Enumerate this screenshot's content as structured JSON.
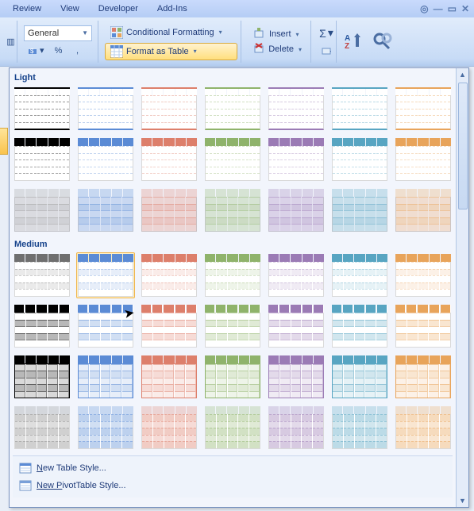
{
  "tabs": {
    "review": "Review",
    "view": "View",
    "developer": "Developer",
    "addins": "Add-Ins"
  },
  "ribbon": {
    "number_format": "General",
    "percent": "%",
    "comma": ",",
    "cond_fmt": "Conditional Formatting",
    "fmt_table": "Format as Table",
    "insert": "Insert",
    "delete": "Delete"
  },
  "gallery": {
    "cat_light": "Light",
    "cat_medium": "Medium",
    "new_table_style": "ew Table Style...",
    "new_table_style_u": "N",
    "new_pivot_style": "ivotTable Style...",
    "new_pivot_style_u": "New P"
  },
  "palette_light": [
    [
      "#000000",
      "#5b8bd5",
      "#dd7f6b",
      "#8fb36b",
      "#9b7bb5",
      "#58a5c2",
      "#e8a45b"
    ],
    [
      "#000000",
      "#5b8bd5",
      "#dd7f6b",
      "#8fb36b",
      "#9b7bb5",
      "#58a5c2",
      "#e8a45b"
    ],
    [
      "#9a9a9a",
      "#5b8bd5",
      "#dd7f6b",
      "#8fb36b",
      "#9b7bb5",
      "#58a5c2",
      "#e8a45b"
    ]
  ],
  "palette_med": [
    [
      "#6f6f6f",
      "#5b8bd5",
      "#dd7f6b",
      "#8fb36b",
      "#9b7bb5",
      "#58a5c2",
      "#e8a45b"
    ],
    [
      "#000000",
      "#5b8bd5",
      "#dd7f6b",
      "#8fb36b",
      "#9b7bb5",
      "#58a5c2",
      "#e8a45b"
    ],
    [
      "#000000",
      "#5b8bd5",
      "#dd7f6b",
      "#8fb36b",
      "#9b7bb5",
      "#58a5c2",
      "#e8a45b"
    ],
    [
      "#8a8a8a",
      "#5b8bd5",
      "#dd7f6b",
      "#8fb36b",
      "#9b7bb5",
      "#58a5c2",
      "#e8a45b"
    ]
  ],
  "light_variants": [
    "outline-white",
    "header-color",
    "header-stripe"
  ],
  "med_variants": [
    "med-header",
    "med-darkhead-band",
    "med-dark-full",
    "med-fill"
  ]
}
